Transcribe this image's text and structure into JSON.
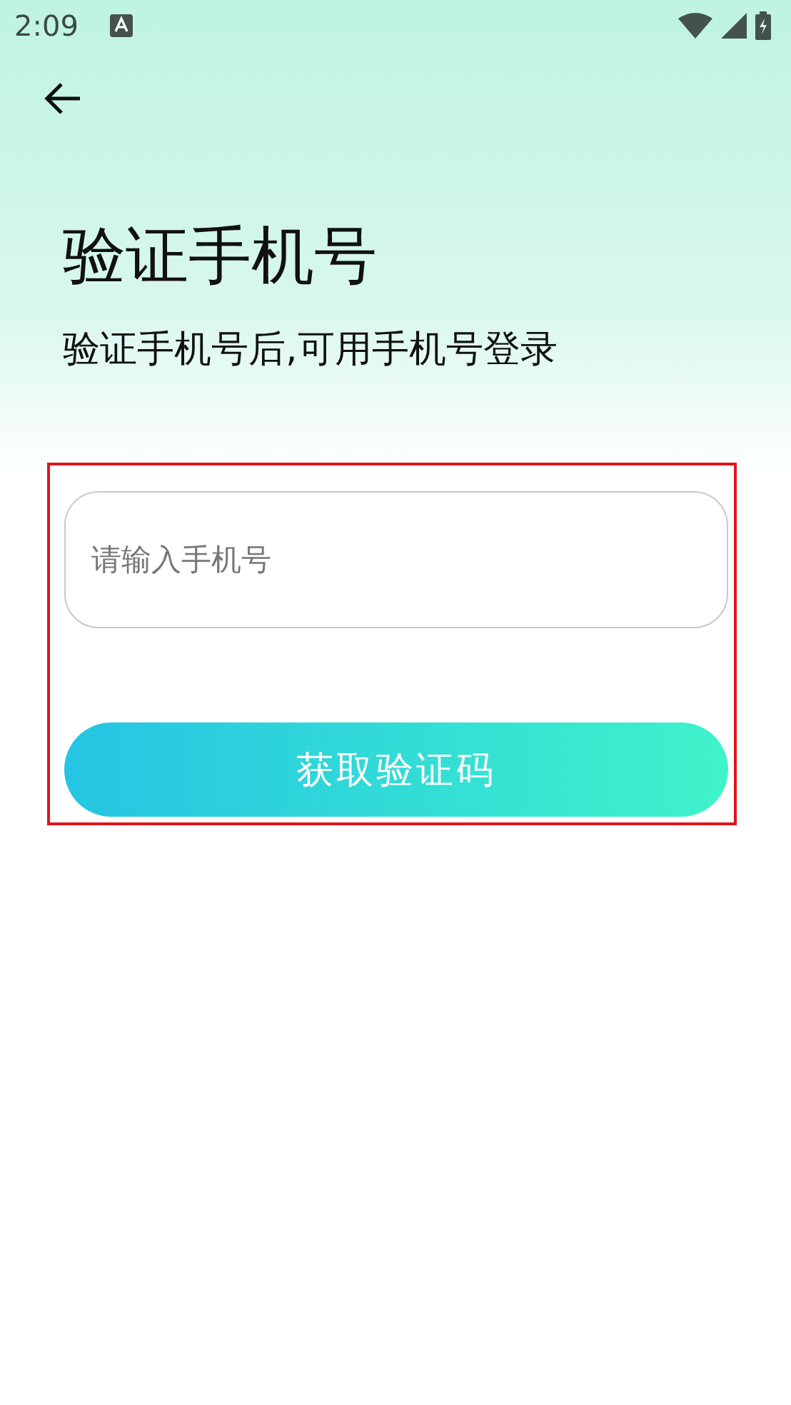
{
  "status_bar": {
    "time": "2:09"
  },
  "title": "验证手机号",
  "subtitle": "验证手机号后,可用手机号登录",
  "phone_field": {
    "placeholder": "请输入手机号"
  },
  "submit_button": {
    "label": "获取验证码"
  }
}
